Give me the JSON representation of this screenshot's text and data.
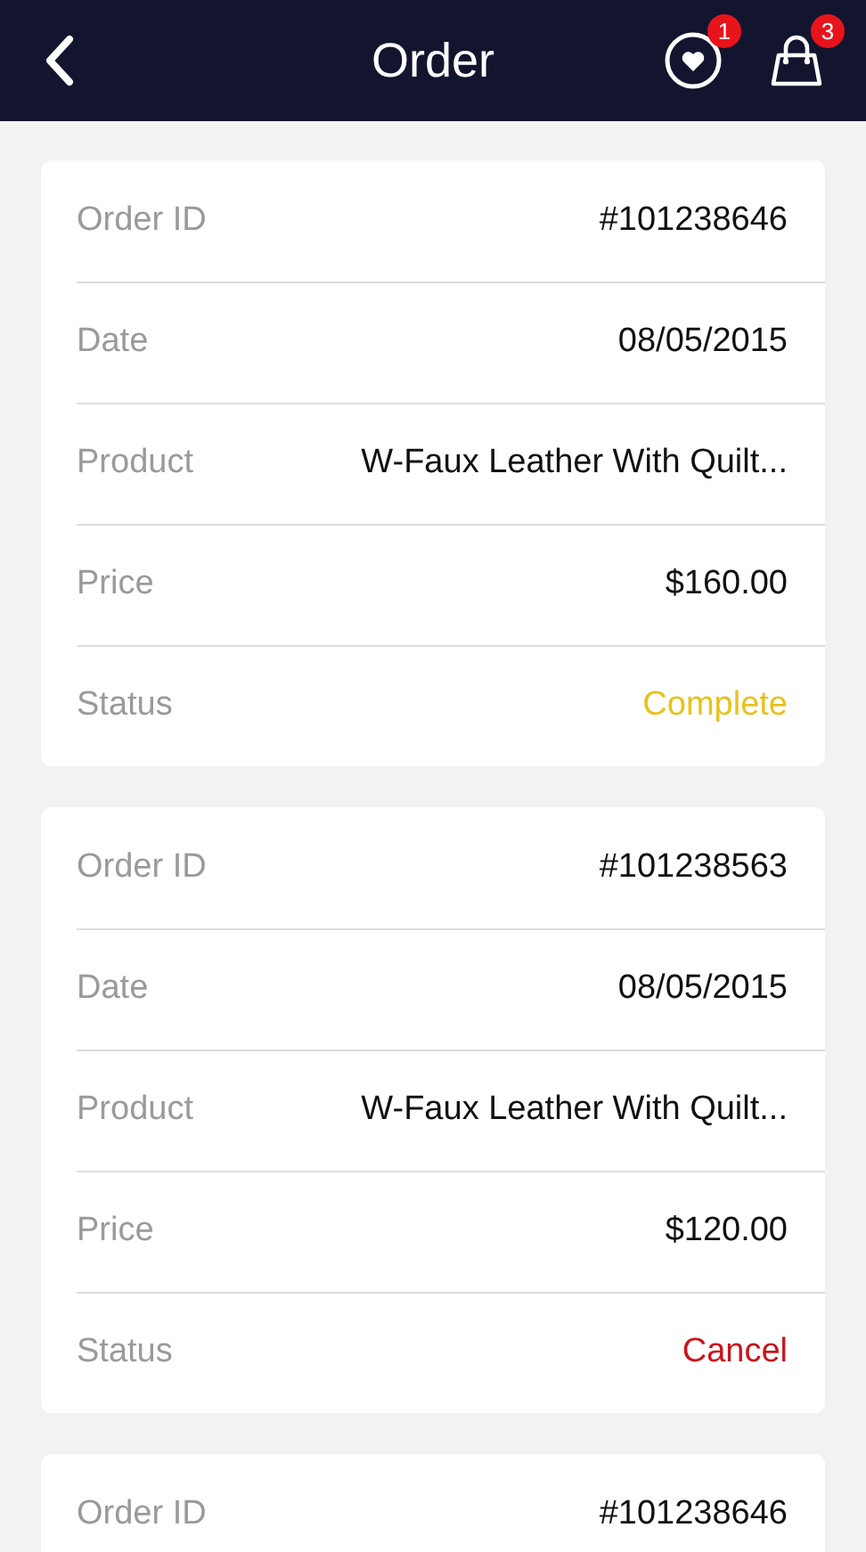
{
  "header": {
    "title": "Order",
    "wishlist_badge": "1",
    "cart_badge": "3"
  },
  "orders": [
    {
      "rows": [
        {
          "label": "Order ID",
          "value": "#101238646"
        },
        {
          "label": "Date",
          "value": "08/05/2015"
        },
        {
          "label": "Product",
          "value": "W-Faux Leather With Quilt..."
        },
        {
          "label": "Price",
          "value": "$160.00"
        },
        {
          "label": "Status",
          "value": "Complete",
          "color": "#e8c21c"
        }
      ]
    },
    {
      "rows": [
        {
          "label": "Order ID",
          "value": "#101238563"
        },
        {
          "label": "Date",
          "value": "08/05/2015"
        },
        {
          "label": "Product",
          "value": "W-Faux Leather With Quilt..."
        },
        {
          "label": "Price",
          "value": "$120.00"
        },
        {
          "label": "Status",
          "value": "Cancel",
          "color": "#c8151b"
        }
      ]
    },
    {
      "rows": [
        {
          "label": "Order ID",
          "value": "#101238646"
        }
      ]
    }
  ]
}
